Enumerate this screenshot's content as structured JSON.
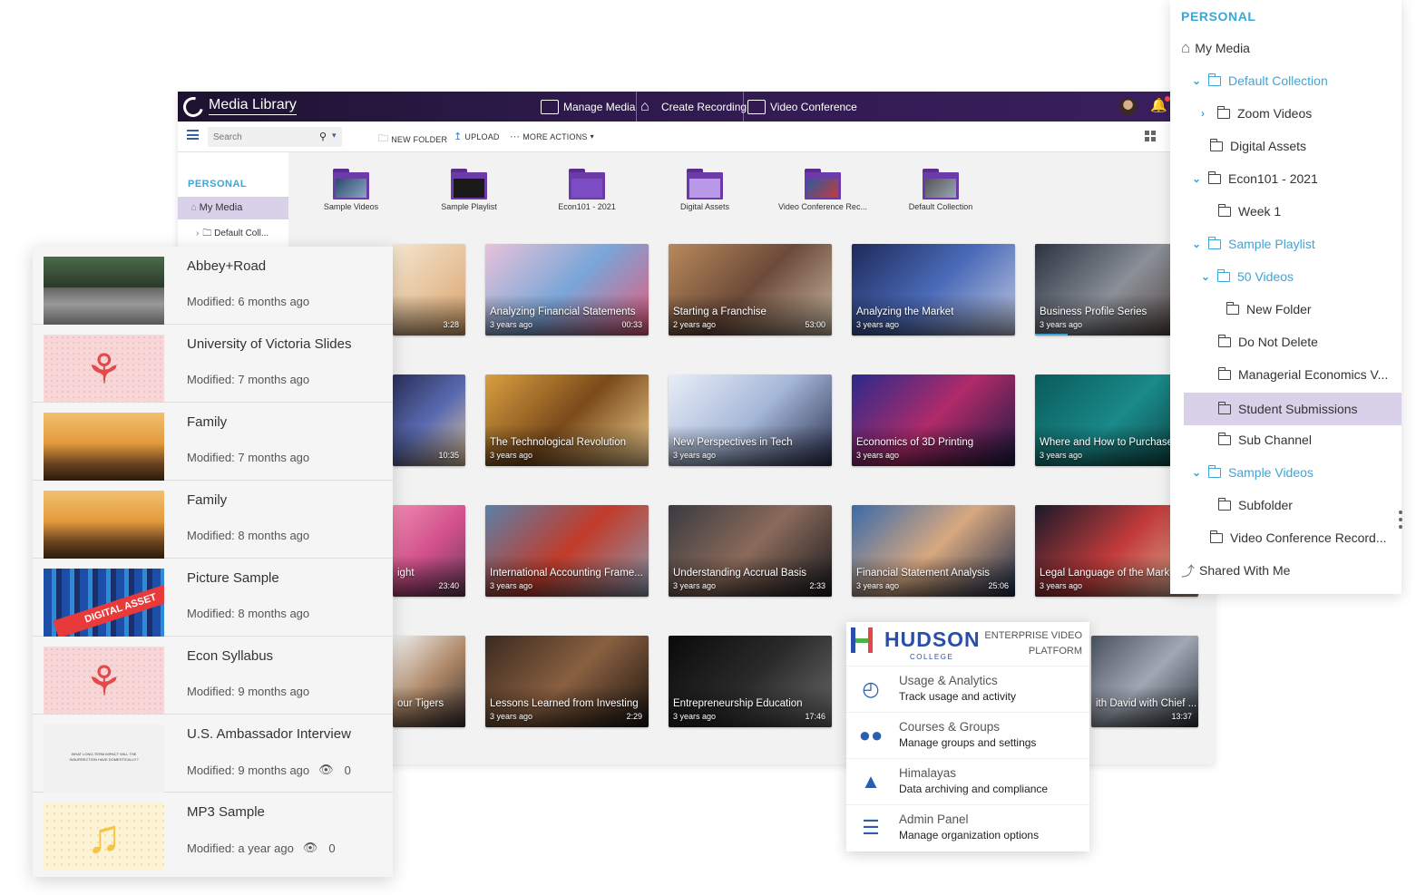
{
  "app": {
    "title": "Media Library",
    "nav": {
      "manage_media": "Manage Media",
      "create_recording": "Create Recording",
      "video_conference": "Video Conference"
    },
    "toolbar": {
      "search_placeholder": "Search",
      "new_folder": "NEW FOLDER",
      "upload": "UPLOAD",
      "more_actions": "MORE ACTIONS"
    },
    "sidebar": {
      "header": "PERSONAL",
      "my_media": "My Media",
      "default_collection": "Default Coll..."
    },
    "folders": [
      {
        "label": "Sample Videos"
      },
      {
        "label": "Sample Playlist"
      },
      {
        "label": "Econ101 - 2021"
      },
      {
        "label": "Digital Assets"
      },
      {
        "label": "Video Conference Rec..."
      },
      {
        "label": "Default Collection"
      }
    ],
    "videos": [
      {
        "title": "",
        "age": "",
        "duration": "3:28"
      },
      {
        "title": "Analyzing Financial Statements",
        "age": "3 years ago",
        "duration": "00:33"
      },
      {
        "title": "Starting a Franchise",
        "age": "2 years ago",
        "duration": "53:00"
      },
      {
        "title": "Analyzing the Market",
        "age": "3 years ago",
        "duration": ""
      },
      {
        "title": "Business Profile Series",
        "age": "3 years ago",
        "duration": ""
      },
      {
        "title": "",
        "age": "",
        "duration": "10:35"
      },
      {
        "title": "The Technological Revolution",
        "age": "3 years ago",
        "duration": ""
      },
      {
        "title": "New Perspectives in Tech",
        "age": "3 years ago",
        "duration": ""
      },
      {
        "title": "Economics of 3D Printing",
        "age": "3 years ago",
        "duration": ""
      },
      {
        "title": "Where and How to Purchase",
        "age": "3 years ago",
        "duration": ""
      },
      {
        "title": "ight",
        "age": "",
        "duration": "23:40"
      },
      {
        "title": "International Accounting Frame...",
        "age": "3 years ago",
        "duration": ""
      },
      {
        "title": "Understanding Accrual Basis",
        "age": "3 years ago",
        "duration": "2:33"
      },
      {
        "title": "Financial Statement Analysis",
        "age": "3 years ago",
        "duration": "25:06"
      },
      {
        "title": "Legal Language of the Marke",
        "age": "3 years ago",
        "duration": ""
      },
      {
        "title": "our Tigers",
        "age": "",
        "duration": ""
      },
      {
        "title": "Lessons Learned from Investing",
        "age": "3 years ago",
        "duration": "2:29"
      },
      {
        "title": "Entrepreneurship Education",
        "age": "3 years ago",
        "duration": "17:46"
      },
      {
        "title": "ith David with Chief ...",
        "age": "",
        "duration": "13:37"
      }
    ]
  },
  "list_panel": {
    "items": [
      {
        "title": "Abbey+Road",
        "modified": "Modified: 6 months ago",
        "views": ""
      },
      {
        "title": "University of Victoria Slides",
        "modified": "Modified: 7 months ago",
        "views": ""
      },
      {
        "title": "Family",
        "modified": "Modified: 7 months ago",
        "views": ""
      },
      {
        "title": "Family",
        "modified": "Modified: 8 months ago",
        "views": ""
      },
      {
        "title": "Picture Sample",
        "modified": "Modified: 8 months ago",
        "views": ""
      },
      {
        "title": "Econ Syllabus",
        "modified": "Modified: 9 months ago",
        "views": ""
      },
      {
        "title": "U.S. Ambassador Interview",
        "modified": "Modified: 9 months ago",
        "views": "0"
      },
      {
        "title": "MP3 Sample",
        "modified": "Modified: a year ago",
        "views": "0"
      }
    ],
    "thumb_texts": {
      "digital_asset": "DIGITAL ASSET",
      "interview_line1": "WHAT LONG-TERM IMPACT WILL THE",
      "interview_line2": "INSURRECTION HAVE DOMESTICALLY?"
    }
  },
  "tree": {
    "header": "PERSONAL",
    "nodes": [
      {
        "label": "My Media"
      },
      {
        "label": "Default Collection"
      },
      {
        "label": "Zoom Videos"
      },
      {
        "label": "Digital Assets"
      },
      {
        "label": "Econ101 - 2021"
      },
      {
        "label": "Week 1"
      },
      {
        "label": "Sample Playlist"
      },
      {
        "label": "50 Videos"
      },
      {
        "label": "New Folder"
      },
      {
        "label": "Do Not Delete"
      },
      {
        "label": "Managerial Economics V..."
      },
      {
        "label": "Student Submissions"
      },
      {
        "label": "Sub Channel"
      },
      {
        "label": "Sample Videos"
      },
      {
        "label": "Subfolder"
      },
      {
        "label": "Video Conference Record..."
      },
      {
        "label": "Shared With Me"
      }
    ]
  },
  "hudson": {
    "name": "HUDSON",
    "sub": "COLLEGE",
    "tagline": "ENTERPRISE VIDEO PLATFORM",
    "items": [
      {
        "title": "Usage & Analytics",
        "subtitle": "Track usage and activity",
        "icon": "analytics-icon"
      },
      {
        "title": "Courses & Groups",
        "subtitle": "Manage groups and settings",
        "icon": "groups-icon"
      },
      {
        "title": "Himalayas",
        "subtitle": "Data archiving and compliance",
        "icon": "mountain-icon"
      },
      {
        "title": "Admin Panel",
        "subtitle": "Manage organization options",
        "icon": "sliders-icon"
      }
    ]
  },
  "colors": {
    "accent_blue": "#3ba6d8",
    "topbar_purple": "#3a1f5e",
    "selected_lavender": "#d9d1ea",
    "folder_purple": "#6c3ba8"
  }
}
